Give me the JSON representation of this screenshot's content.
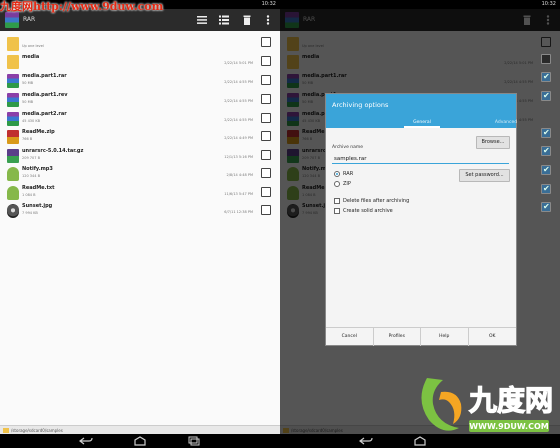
{
  "watermark": {
    "top_text": "九度网http://www.9duw.com",
    "logo_text": "九度网",
    "logo_url": "WWW.9DUW.COM"
  },
  "status_bar": {
    "time": "10:32"
  },
  "app": {
    "title": "RAR"
  },
  "action_bar": {
    "icons": [
      "list-icon",
      "select-all-icon",
      "delete-icon",
      "overflow-menu-icon"
    ]
  },
  "files": [
    {
      "name": "",
      "size": "Up one level",
      "date": "",
      "icon": "folder-up-icon",
      "checked": false
    },
    {
      "name": "media",
      "size": "",
      "date": "2/22/14 5:01 PM",
      "icon": "folder-icon",
      "checked": true
    },
    {
      "name": "media.part1.rar",
      "size": "50 MB",
      "date": "2/22/14 4:55 PM",
      "icon": "rar-archive-icon",
      "checked": true
    },
    {
      "name": "media.part1.rev",
      "size": "50 MB",
      "date": "2/22/14 4:55 PM",
      "icon": "rar-archive-icon",
      "checked": true
    },
    {
      "name": "media.part2.rar",
      "size": "45 430 KB",
      "date": "2/22/14 4:55 PM",
      "icon": "rar-archive-icon",
      "checked": true
    },
    {
      "name": "ReadMe.zip",
      "size": "766 B",
      "date": "2/22/14 4:49 PM",
      "icon": "zip-archive-icon",
      "checked": true
    },
    {
      "name": "unrarsrc-5.0.14.tar.gz",
      "size": "209 707 B",
      "date": "12/1/13 5:16 PM",
      "icon": "tgz-archive-icon",
      "checked": true
    },
    {
      "name": "Notify.mp3",
      "size": "120 344 B",
      "date": "2/8/14 4:48 PM",
      "icon": "audio-file-icon",
      "checked": true
    },
    {
      "name": "ReadMe.txt",
      "size": "1 084 B",
      "date": "11/6/13 5:47 PM",
      "icon": "text-file-icon",
      "checked": true
    },
    {
      "name": "Sunset.jpg",
      "size": "7 994 KB",
      "date": "6/7/11 12:38 PM",
      "icon": "image-file-icon",
      "checked": true
    }
  ],
  "path": {
    "text": "/storage/sdcard0/samples"
  },
  "dialog": {
    "title": "Archiving options",
    "tabs": {
      "general": "General",
      "advanced": "Advanced"
    },
    "archive_name_label": "Archive name",
    "archive_name_value": "samples.rar",
    "browse_label": "Browse...",
    "set_password_label": "Set password...",
    "format_options": [
      "RAR",
      "ZIP"
    ],
    "selected_format": "RAR",
    "delete_after_label": "Delete files after archiving",
    "solid_label": "Create solid archive",
    "footer": {
      "cancel": "Cancel",
      "profiles": "Profiles",
      "help": "Help",
      "ok": "OK"
    }
  },
  "colors": {
    "accent": "#3aa4d9",
    "action_bar": "#2b2b2b",
    "watermark_red": "#e52a14",
    "logo_green": "#7cc242"
  }
}
